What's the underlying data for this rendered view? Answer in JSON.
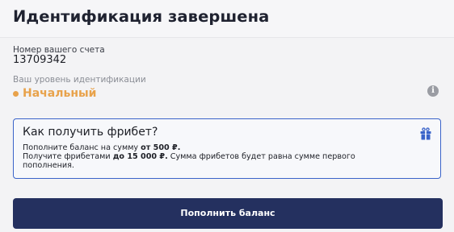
{
  "header": {
    "title": "Идентификация завершена"
  },
  "account": {
    "label": "Номер вашего счета",
    "number": "13709342"
  },
  "identification": {
    "label": "Ваш уровень идентификации",
    "level": "Начальный",
    "level_color": "#e8a24b",
    "info_icon": "info-icon",
    "info_glyph": "i"
  },
  "freebet": {
    "title": "Как получить фрибет?",
    "line1_prefix": "Пополните баланс на сумму ",
    "line1_bold": "от 500 ₽.",
    "line2_prefix": "Получите фрибетами ",
    "line2_bold": "до 15 000 ₽.",
    "line2_suffix": " Сумма фрибетов будет равна сумме первого",
    "line3": "пополнения.",
    "gift_icon": "gift-icon",
    "accent_color": "#3a63c9"
  },
  "actions": {
    "topup_label": "Пополнить баланс",
    "topup_color": "#24305f"
  }
}
